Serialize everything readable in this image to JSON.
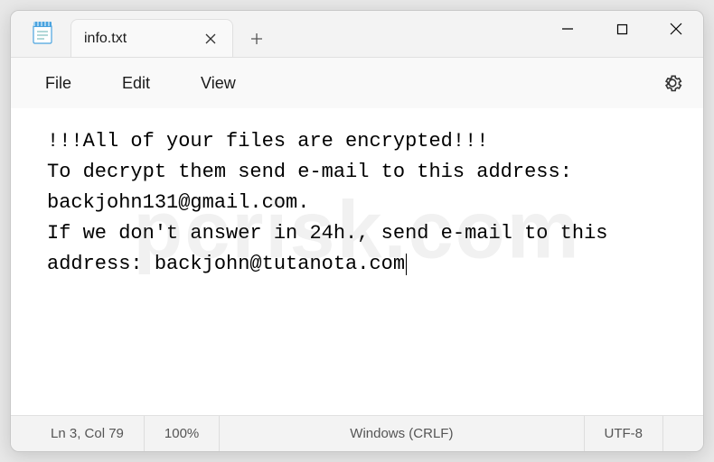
{
  "tab": {
    "title": "info.txt"
  },
  "menu": {
    "file": "File",
    "edit": "Edit",
    "view": "View"
  },
  "content": {
    "text": "!!!All of your files are encrypted!!!\nTo decrypt them send e-mail to this address: backjohn131@gmail.com.\nIf we don't answer in 24h., send e-mail to this address: backjohn@tutanota.com"
  },
  "status": {
    "position": "Ln 3, Col 79",
    "zoom": "100%",
    "eol": "Windows (CRLF)",
    "encoding": "UTF-8"
  },
  "watermark": "pcrisk.com"
}
